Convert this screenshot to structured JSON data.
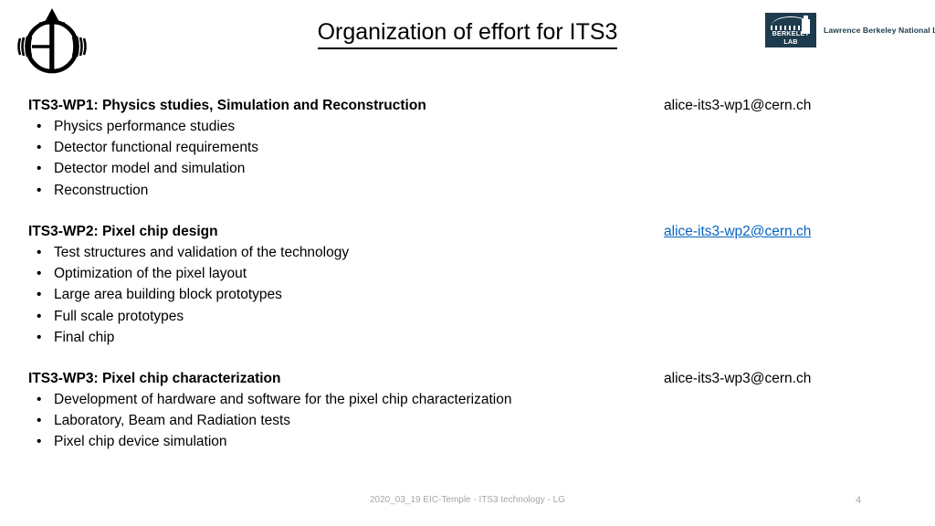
{
  "slide": {
    "title": "Organization of effort for ITS3",
    "background_color": "#ffffff",
    "link_color": "#0563c1",
    "footer_color": "#a6a6a6"
  },
  "logos": {
    "eic": {
      "name": "eic-logo",
      "alt": "Electron-Ion Collider logo"
    },
    "lbnl": {
      "mark_text": "BERKELEY LAB",
      "full_name": "Lawrence Berkeley National Laboratory",
      "background_color": "#1d3b4d"
    }
  },
  "work_packages": [
    {
      "id": "wp1",
      "heading": "ITS3-WP1: Physics studies, Simulation and Reconstruction",
      "email": "alice-its3-wp1@cern.ch",
      "email_is_link": false,
      "bullet_char": "•",
      "items": [
        "Physics performance studies",
        "Detector functional requirements",
        "Detector model and simulation",
        "Reconstruction"
      ]
    },
    {
      "id": "wp2",
      "heading": "ITS3-WP2: Pixel chip design",
      "email": "alice-its3-wp2@cern.ch",
      "email_is_link": true,
      "bullet_char": "•",
      "items": [
        "Test structures and validation of the technology",
        "Optimization of the pixel layout",
        "Large area building block prototypes",
        "Full scale prototypes",
        "Final chip"
      ]
    },
    {
      "id": "wp3",
      "heading": "ITS3-WP3: Pixel chip characterization",
      "email": "alice-its3-wp3@cern.ch",
      "email_is_link": false,
      "bullet_char": "•",
      "items": [
        "Development of hardware and software for the pixel chip characterization",
        "Laboratory, Beam and Radiation tests",
        "Pixel chip device simulation"
      ]
    }
  ],
  "footer": {
    "text": "2020_03_19 EIC-Temple  - ITS3 technology - LG",
    "page_number": "4"
  }
}
